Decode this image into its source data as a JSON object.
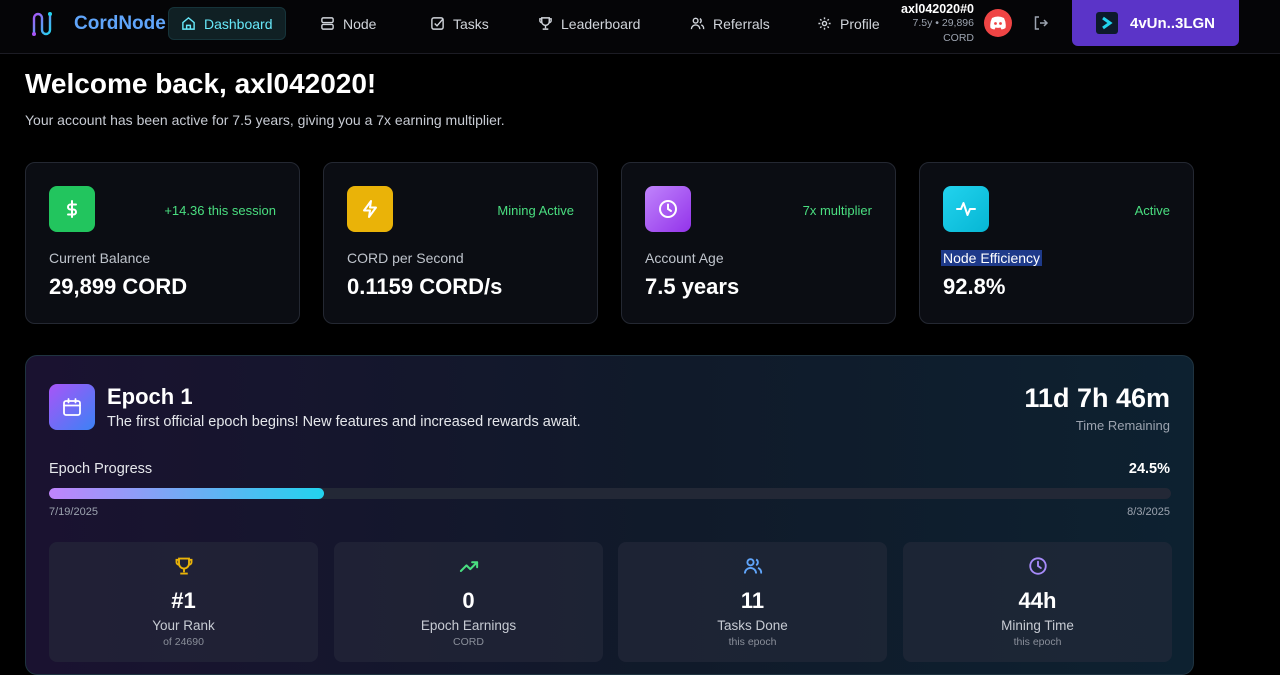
{
  "brand": {
    "name": "CordNode"
  },
  "nav": {
    "items": [
      {
        "label": "Dashboard",
        "icon": "home-icon",
        "active": true
      },
      {
        "label": "Node",
        "icon": "server-icon"
      },
      {
        "label": "Tasks",
        "icon": "checkbox-icon"
      },
      {
        "label": "Leaderboard",
        "icon": "trophy-icon"
      },
      {
        "label": "Referrals",
        "icon": "users-icon"
      },
      {
        "label": "Profile",
        "icon": "gear-icon"
      }
    ]
  },
  "user": {
    "name": "axl042020#0",
    "meta": "7.5y • 29,896",
    "unit": "CORD"
  },
  "wallet": {
    "label": "4vUn..3LGN"
  },
  "welcome": {
    "title": "Welcome back, axl042020!",
    "subtitle": "Your account has been active for 7.5 years, giving you a 7x earning multiplier."
  },
  "stats": [
    {
      "icon": "dollar-icon",
      "status": "+14.36 this session",
      "label": "Current Balance",
      "value": "29,899 CORD",
      "color": "#22c55e"
    },
    {
      "icon": "lightning-icon",
      "status": "Mining Active",
      "label": "CORD per Second",
      "value": "0.1159 CORD/s",
      "color": "#eab308"
    },
    {
      "icon": "clock-icon",
      "status": "7x multiplier",
      "label": "Account Age",
      "value": "7.5 years",
      "color": "#a855f7"
    },
    {
      "icon": "activity-icon",
      "status": "Active",
      "label": "Node Efficiency",
      "value": "92.8%",
      "color": "#22d3ee"
    }
  ],
  "epoch": {
    "title": "Epoch 1",
    "description": "The first official epoch begins! New features and increased rewards await.",
    "time_remaining": "11d 7h 46m",
    "time_label": "Time Remaining",
    "progress_label": "Epoch Progress",
    "progress_pct": "24.5%",
    "progress_value": 0.245,
    "start_date": "7/19/2025",
    "end_date": "8/3/2025",
    "metrics": [
      {
        "icon": "trophy-icon",
        "value": "#1",
        "label": "Your Rank",
        "sub": "of 24690",
        "color": "#eab308"
      },
      {
        "icon": "trending-up-icon",
        "value": "0",
        "label": "Epoch Earnings",
        "sub": "CORD",
        "color": "#4ade80"
      },
      {
        "icon": "users-icon",
        "value": "11",
        "label": "Tasks Done",
        "sub": "this epoch",
        "color": "#60a5fa"
      },
      {
        "icon": "clock-icon",
        "value": "44h",
        "label": "Mining Time",
        "sub": "this epoch",
        "color": "#a78bfa"
      }
    ]
  }
}
